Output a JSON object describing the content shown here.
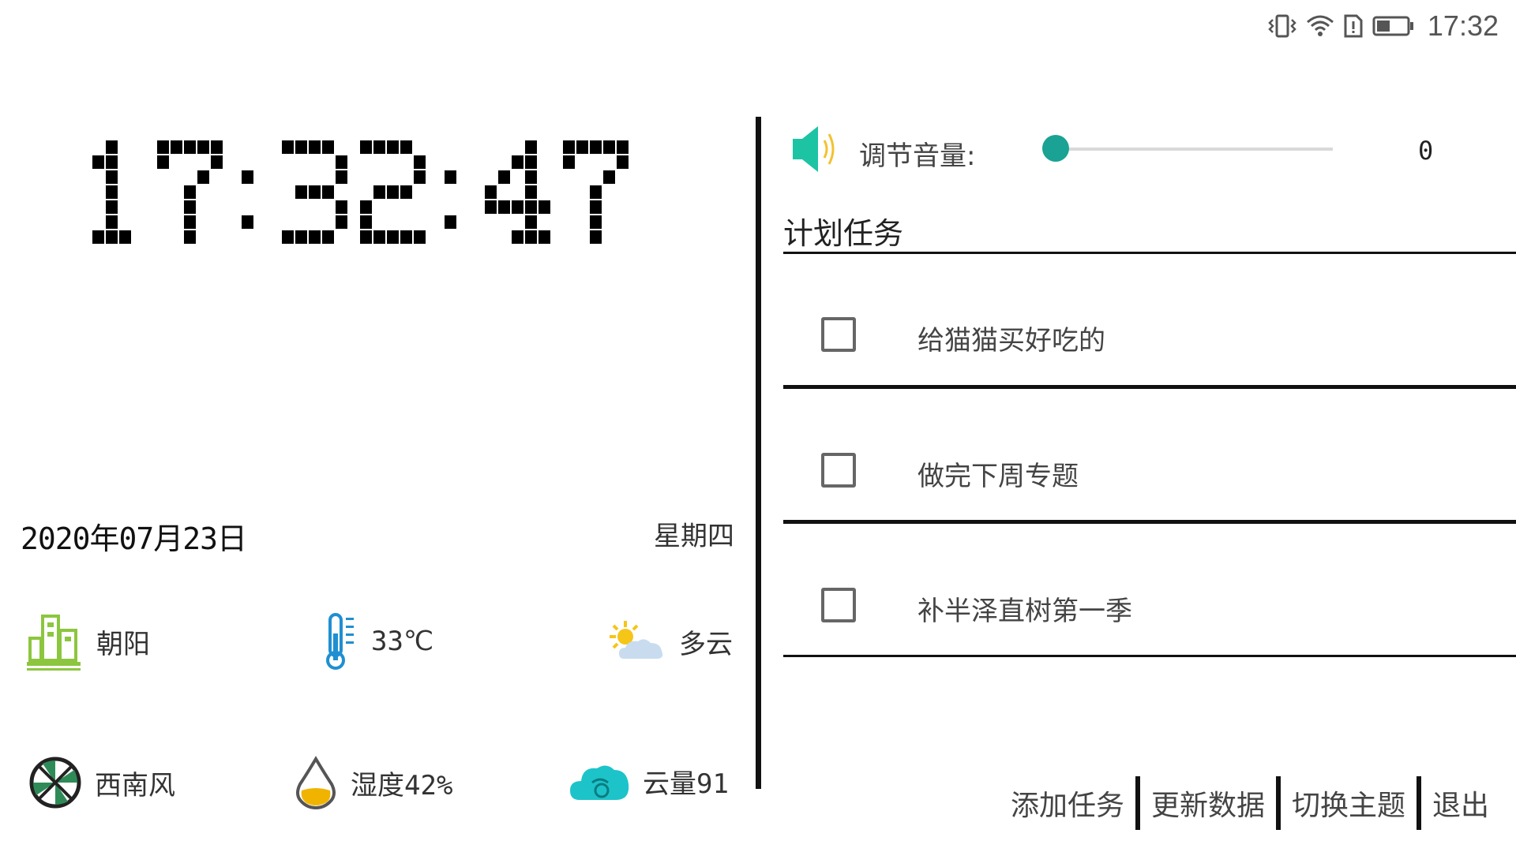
{
  "status_bar": {
    "time": "17:32",
    "icons": [
      "vibrate-icon",
      "wifi-icon",
      "sim-icon",
      "battery-icon"
    ]
  },
  "clock": {
    "time": "17:32:47"
  },
  "date": {
    "text": "2020年07月23日",
    "weekday": "星期四"
  },
  "weather": {
    "location": "朝阳",
    "temperature": "33℃",
    "condition": "多云",
    "wind": "西南风",
    "humidity": "湿度42%",
    "cloud": "云量91"
  },
  "volume": {
    "label": "调节音量:",
    "value": "0",
    "level": 0
  },
  "tasks": {
    "title": "计划任务",
    "items": [
      {
        "text": "给猫猫买好吃的",
        "checked": false
      },
      {
        "text": "做完下周专题",
        "checked": false
      },
      {
        "text": "补半泽直树第一季",
        "checked": false
      }
    ]
  },
  "buttons": {
    "add_task": "添加任务",
    "update_data": "更新数据",
    "switch_theme": "切换主题",
    "exit": "退出"
  },
  "colors": {
    "accent": "#1aa294",
    "divider": "#111111",
    "location_icon": "#8cc63f",
    "temperature_icon": "#1f8fd1",
    "sun": "#f5c518",
    "humidity_drop": "#f0b400",
    "cloud_icon": "#1cc4c9"
  }
}
